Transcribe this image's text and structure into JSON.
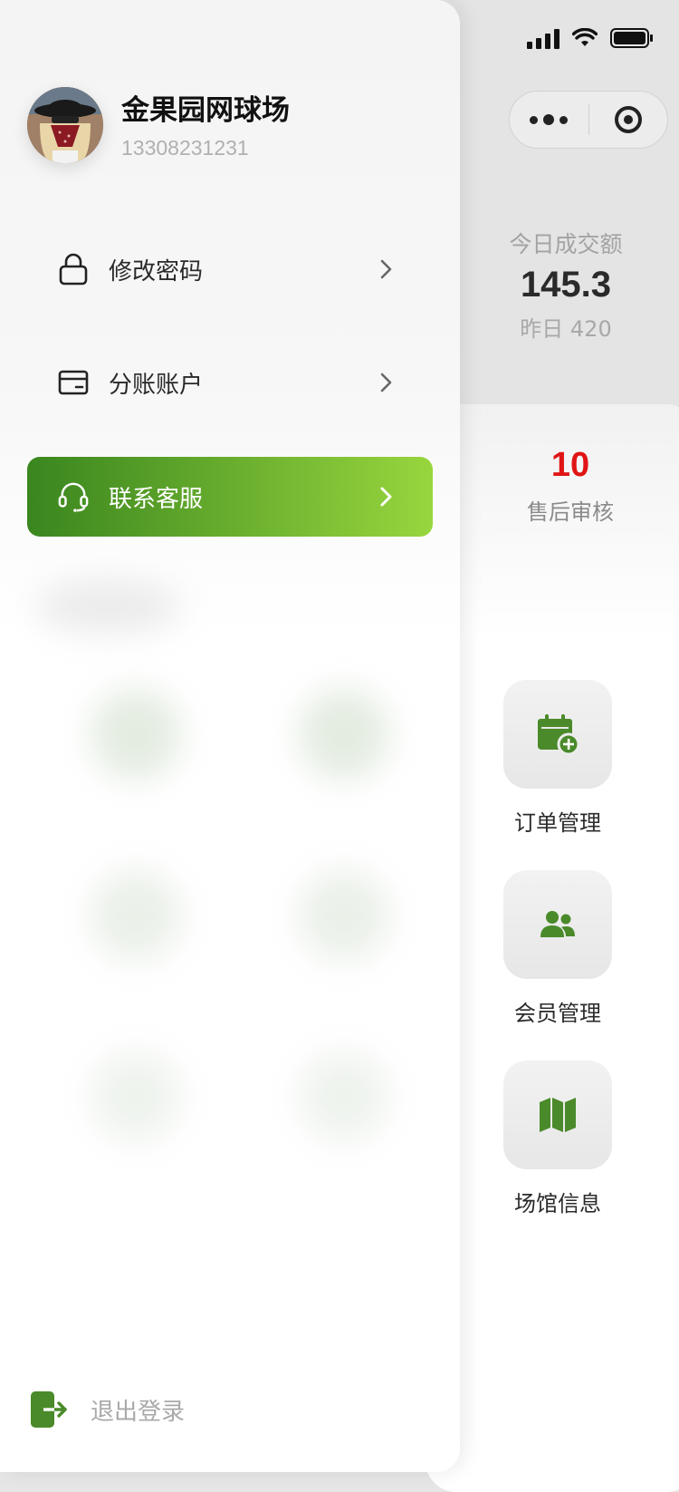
{
  "app": {
    "stats": {
      "today_label": "今日成交额",
      "today_value": "145.3",
      "yesterday_label": "昨日 420"
    },
    "pending": {
      "count": "10",
      "label": "售后审核"
    },
    "tiles": [
      {
        "label": "订单管理",
        "icon": "calendar-plus-icon"
      },
      {
        "label": "会员管理",
        "icon": "users-icon"
      },
      {
        "label": "场馆信息",
        "icon": "map-icon"
      }
    ],
    "colors": {
      "accent_green": "#4a8a2a",
      "alert_red": "#e01515"
    }
  },
  "drawer": {
    "venue_name": "金果园网球场",
    "phone": "13308231231",
    "menu": [
      {
        "label": "修改密码",
        "icon": "lock-icon"
      },
      {
        "label": "分账账户",
        "icon": "wallet-icon"
      },
      {
        "label": "联系客服",
        "icon": "headset-icon",
        "active": true
      }
    ],
    "logout_label": "退出登录",
    "active_gradient": [
      "#3a861f",
      "#98d63e"
    ]
  }
}
